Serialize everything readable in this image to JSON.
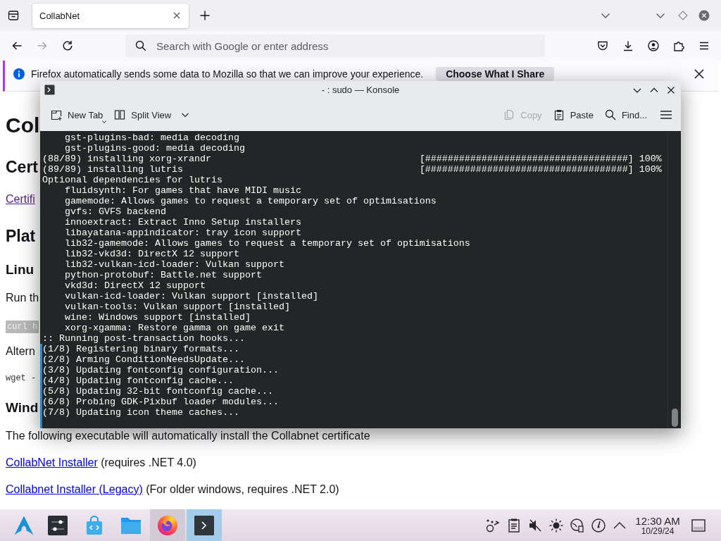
{
  "browser": {
    "tabs": [
      {
        "title": "CollabNet",
        "selected": true
      }
    ],
    "nav_buttons": [
      {
        "disabled": false
      },
      {
        "disabled": true
      },
      {
        "disabled": false
      }
    ],
    "address_bar": {
      "placeholder": "Search with Google or enter address"
    },
    "notification": {
      "text": "Firefox automatically sends some data to Mozilla so that we can improve your experience.",
      "button": "Choose What I Share"
    }
  },
  "page": {
    "blocks": [
      {
        "kind": "heading1",
        "text": "Col"
      },
      {
        "kind": "heading2",
        "text": "Cert"
      },
      {
        "kind": "link",
        "text": "Certifi",
        "visited": true
      },
      {
        "kind": "heading2",
        "text": "Plat"
      },
      {
        "kind": "heading3",
        "text": "Linu"
      },
      {
        "kind": "text",
        "text": "Run th"
      },
      {
        "kind": "code",
        "text": "curl h"
      },
      {
        "kind": "text",
        "text": "Altern"
      },
      {
        "kind": "command",
        "text": "wget -"
      },
      {
        "kind": "heading3",
        "text": "Wind"
      },
      {
        "kind": "text",
        "text": "The following executable will automatically install the Collabnet certificate"
      },
      {
        "kind": "link_note",
        "link": "CollabNet Installer",
        "visited": false,
        "note": "(requires .NET 4.0)"
      },
      {
        "kind": "link_note",
        "link": "Collabnet Installer (Legacy)",
        "visited": false,
        "note": "(For older windows, requires .NET 2.0)"
      }
    ]
  },
  "konsole": {
    "title": "- : sudo — Konsole",
    "toolbar_left": [
      {
        "label": "New Tab",
        "disabled": false
      },
      {
        "label": "Split View",
        "disabled": false
      }
    ],
    "toolbar_right": [
      {
        "label": "Copy",
        "disabled": true
      },
      {
        "label": "Paste",
        "disabled": false
      },
      {
        "label": "Find...",
        "disabled": false
      }
    ],
    "output": [
      {
        "kind": "item",
        "text": "gst-plugins-bad: media decoding"
      },
      {
        "kind": "item",
        "text": "gst-plugins-good: media decoding"
      },
      {
        "kind": "progress",
        "text": "(88/89) installing xorg-xrandr",
        "bar": "[####################################] 100%"
      },
      {
        "kind": "progress",
        "text": "(89/89) installing lutris",
        "bar": "[####################################] 100%"
      },
      {
        "kind": "plain",
        "text": "Optional dependencies for lutris"
      },
      {
        "kind": "item",
        "text": "fluidsynth: For games that have MIDI music"
      },
      {
        "kind": "item",
        "text": "gamemode: Allows games to request a temporary set of optimisations"
      },
      {
        "kind": "item",
        "text": "gvfs: GVFS backend"
      },
      {
        "kind": "item",
        "text": "innoextract: Extract Inno Setup installers"
      },
      {
        "kind": "item",
        "text": "libayatana-appindicator: tray icon support"
      },
      {
        "kind": "item",
        "text": "lib32-gamemode: Allows games to request a temporary set of optimisations"
      },
      {
        "kind": "item",
        "text": "lib32-vkd3d: DirectX 12 support"
      },
      {
        "kind": "item",
        "text": "lib32-vulkan-icd-loader: Vulkan support"
      },
      {
        "kind": "item",
        "text": "python-protobuf: Battle.net support"
      },
      {
        "kind": "item",
        "text": "vkd3d: DirectX 12 support"
      },
      {
        "kind": "item",
        "text": "vulkan-icd-loader: Vulkan support [installed]"
      },
      {
        "kind": "item",
        "text": "vulkan-tools: Vulkan support [installed]"
      },
      {
        "kind": "item",
        "text": "wine: Windows support [installed]"
      },
      {
        "kind": "item",
        "text": "xorg-xgamma: Restore gamma on game exit"
      },
      {
        "kind": "plain",
        "text": ":: Running post-transaction hooks..."
      }
    ],
    "new_output": [
      {
        "kind": "plain",
        "text": "(1/8) Registering binary formats..."
      },
      {
        "kind": "plain",
        "text": "(2/8) Arming ConditionNeedsUpdate..."
      },
      {
        "kind": "plain",
        "text": "(3/8) Updating fontconfig configuration..."
      },
      {
        "kind": "plain",
        "text": "(4/8) Updating fontconfig cache..."
      },
      {
        "kind": "plain",
        "text": "(5/8) Updating 32-bit fontconfig cache..."
      },
      {
        "kind": "plain",
        "text": "(6/8) Probing GDK-Pixbuf loader modules..."
      },
      {
        "kind": "plain",
        "text": "(7/8) Updating icon theme caches..."
      }
    ]
  },
  "taskbar": {
    "tasks": [
      {
        "open": false,
        "selected": false
      },
      {
        "open": false,
        "selected": false
      },
      {
        "open": false,
        "selected": false
      },
      {
        "open": true,
        "selected": false
      },
      {
        "open": true,
        "selected": true
      }
    ],
    "tray": {
      "audio_muted": true
    },
    "clock": {
      "time": "12:30 AM",
      "date": "10/29/24"
    }
  }
}
